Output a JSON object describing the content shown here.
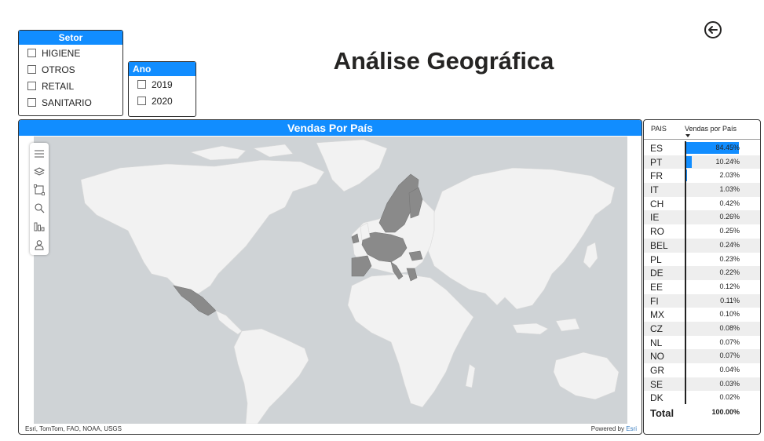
{
  "title": "Análise Geográfica",
  "setor_slicer": {
    "header": "Setor",
    "items": [
      "HIGIENE",
      "OTROS",
      "RETAIL",
      "SANITARIO"
    ]
  },
  "ano_slicer": {
    "header": "Ano",
    "items": [
      "2019",
      "2020"
    ]
  },
  "map": {
    "header": "Vendas Por País",
    "attribution": "Esri, TomTom, FAO, NOAA, USGS",
    "powered_prefix": "Powered by ",
    "powered_brand": "Esri",
    "toolbar": [
      "menu-icon",
      "layers-icon",
      "select-rectangle-icon",
      "search-icon",
      "legend-icon",
      "person-icon"
    ]
  },
  "table": {
    "col_pais": "PAIS",
    "col_vendas": "Vendas por País",
    "rows": [
      {
        "pais": "ES",
        "value": 84.45,
        "label": "84.45%"
      },
      {
        "pais": "PT",
        "value": 10.24,
        "label": "10.24%"
      },
      {
        "pais": "FR",
        "value": 2.03,
        "label": "2.03%"
      },
      {
        "pais": "IT",
        "value": 1.03,
        "label": "1.03%"
      },
      {
        "pais": "CH",
        "value": 0.42,
        "label": "0.42%"
      },
      {
        "pais": "IE",
        "value": 0.26,
        "label": "0.26%"
      },
      {
        "pais": "RO",
        "value": 0.25,
        "label": "0.25%"
      },
      {
        "pais": "BEL",
        "value": 0.24,
        "label": "0.24%"
      },
      {
        "pais": "PL",
        "value": 0.23,
        "label": "0.23%"
      },
      {
        "pais": "DE",
        "value": 0.22,
        "label": "0.22%"
      },
      {
        "pais": "EE",
        "value": 0.12,
        "label": "0.12%"
      },
      {
        "pais": "FI",
        "value": 0.11,
        "label": "0.11%"
      },
      {
        "pais": "MX",
        "value": 0.1,
        "label": "0.10%"
      },
      {
        "pais": "CZ",
        "value": 0.08,
        "label": "0.08%"
      },
      {
        "pais": "NL",
        "value": 0.07,
        "label": "0.07%"
      },
      {
        "pais": "NO",
        "value": 0.07,
        "label": "0.07%"
      },
      {
        "pais": "GR",
        "value": 0.04,
        "label": "0.04%"
      },
      {
        "pais": "SE",
        "value": 0.03,
        "label": "0.03%"
      },
      {
        "pais": "DK",
        "value": 0.02,
        "label": "0.02%"
      }
    ],
    "total_label": "Total",
    "total_value": "100.00%"
  },
  "colors": {
    "accent": "#118dff",
    "ocean": "#cfd3d6",
    "land": "#f2f2f2",
    "highlight": "#8a8a8a"
  }
}
